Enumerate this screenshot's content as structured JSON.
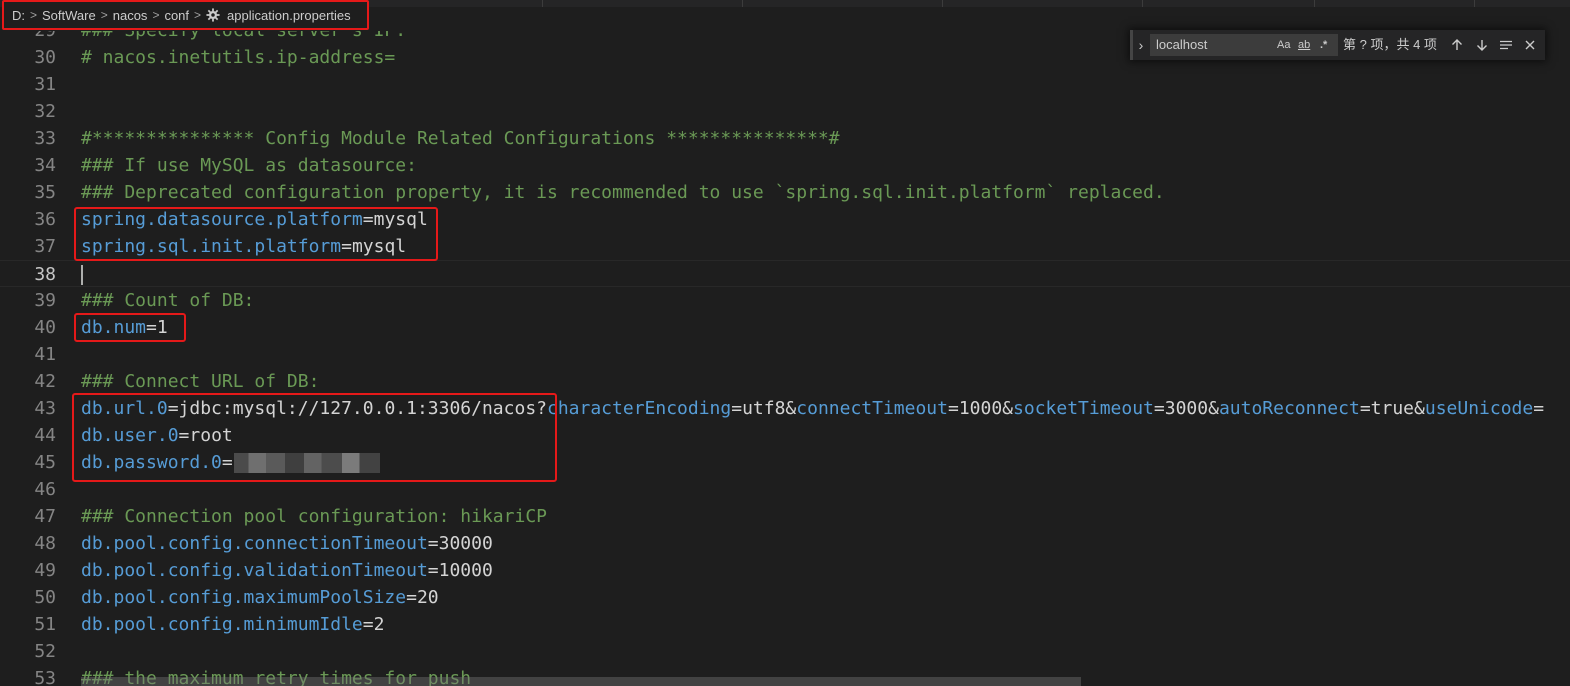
{
  "breadcrumb": [
    "D:",
    "SoftWare",
    "nacos",
    "conf"
  ],
  "breadcrumb_file": "application.properties",
  "find": {
    "query": "localhost",
    "case_label": "Aa",
    "word_label": "ab",
    "regex_label": ".*",
    "result": "第 ? 项，共 4 项"
  },
  "lines": [
    {
      "n": "29",
      "kind": "comment",
      "text": "### Specify local server's IP:"
    },
    {
      "n": "30",
      "kind": "comment",
      "text": "# nacos.inetutils.ip-address="
    },
    {
      "n": "31",
      "kind": "blank"
    },
    {
      "n": "32",
      "kind": "blank"
    },
    {
      "n": "33",
      "kind": "comment",
      "text": "#*************** Config Module Related Configurations ***************#"
    },
    {
      "n": "34",
      "kind": "comment",
      "text": "### If use MySQL as datasource:"
    },
    {
      "n": "35",
      "kind": "comment",
      "text": "### Deprecated configuration property, it is recommended to use `spring.sql.init.platform` replaced."
    },
    {
      "n": "36",
      "kind": "prop",
      "key": "spring.datasource.platform",
      "value": "mysql"
    },
    {
      "n": "37",
      "kind": "prop",
      "key": "spring.sql.init.platform",
      "value": "mysql"
    },
    {
      "n": "38",
      "kind": "blank"
    },
    {
      "n": "39",
      "kind": "comment",
      "text": "### Count of DB:"
    },
    {
      "n": "40",
      "kind": "prop",
      "key": "db.num",
      "value": "1"
    },
    {
      "n": "41",
      "kind": "blank"
    },
    {
      "n": "42",
      "kind": "comment",
      "text": "### Connect URL of DB:"
    },
    {
      "n": "43",
      "kind": "url"
    },
    {
      "n": "44",
      "kind": "prop",
      "key": "db.user.0",
      "value": "root"
    },
    {
      "n": "45",
      "kind": "password",
      "key": "db.password.0"
    },
    {
      "n": "46",
      "kind": "blank"
    },
    {
      "n": "47",
      "kind": "comment",
      "text": "### Connection pool configuration: hikariCP"
    },
    {
      "n": "48",
      "kind": "prop",
      "key": "db.pool.config.connectionTimeout",
      "value": "30000"
    },
    {
      "n": "49",
      "kind": "prop",
      "key": "db.pool.config.validationTimeout",
      "value": "10000"
    },
    {
      "n": "50",
      "kind": "prop",
      "key": "db.pool.config.maximumPoolSize",
      "value": "20"
    },
    {
      "n": "51",
      "kind": "prop",
      "key": "db.pool.config.minimumIdle",
      "value": "2"
    },
    {
      "n": "52",
      "kind": "blank"
    },
    {
      "n": "53",
      "kind": "comment",
      "text": "### the maximum retry times for push"
    }
  ],
  "url_line": [
    {
      "t": "db.url.0",
      "c": "key"
    },
    {
      "t": "=jdbc:mysql://127.0.0.1:3306/nacos?",
      "c": "val"
    },
    {
      "t": "characterEncoding",
      "c": "key"
    },
    {
      "t": "=utf8&",
      "c": "val"
    },
    {
      "t": "connectTimeout",
      "c": "key"
    },
    {
      "t": "=1000&",
      "c": "val"
    },
    {
      "t": "socketTimeout",
      "c": "key"
    },
    {
      "t": "=3000&",
      "c": "val"
    },
    {
      "t": "autoReconnect",
      "c": "key"
    },
    {
      "t": "=true&",
      "c": "val"
    },
    {
      "t": "useUnicode",
      "c": "key"
    },
    {
      "t": "=",
      "c": "val"
    }
  ],
  "active_line": "38"
}
